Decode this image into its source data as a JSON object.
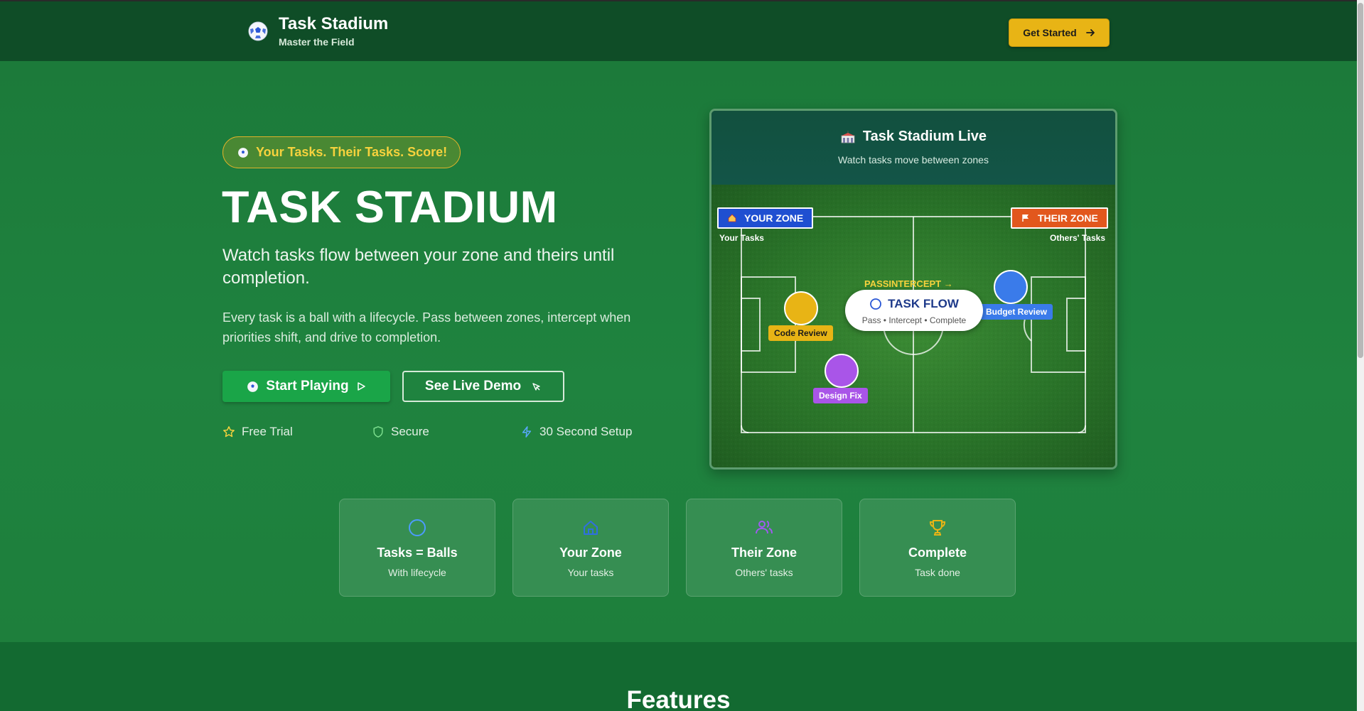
{
  "header": {
    "brand_title": "Task Stadium",
    "brand_subtitle": "Master the Field",
    "cta_label": "Get Started"
  },
  "hero": {
    "pill": "Your Tasks. Their Tasks. Score!",
    "title": "TASK STADIUM",
    "subtitle": "Watch tasks flow between your zone and theirs until completion.",
    "body": "Every task is a ball with a lifecycle. Pass between zones, intercept when priorities shift, and drive to completion.",
    "primary_button": "Start Playing",
    "secondary_button": "See Live Demo",
    "trust": [
      {
        "icon": "star-icon",
        "label": "Free Trial"
      },
      {
        "icon": "shield-icon",
        "label": "Secure"
      },
      {
        "icon": "lightning-icon",
        "label": "30 Second Setup"
      }
    ]
  },
  "demo": {
    "title": "Task Stadium Live",
    "subtitle": "Watch tasks move between zones",
    "your_zone": "YOUR ZONE",
    "your_zone_label": "Your Tasks",
    "their_zone": "THEIR ZONE",
    "their_zone_label": "Others' Tasks",
    "pass_label": "PASSINTERCEPT →",
    "flow_title": "TASK FLOW",
    "flow_sub": "Pass • Intercept • Complete",
    "balls": [
      {
        "label": "Code Review"
      },
      {
        "label": "Design Fix"
      },
      {
        "label": "Budget Review"
      }
    ]
  },
  "features": [
    {
      "icon": "circle-icon",
      "title": "Tasks = Balls",
      "subtitle": "With lifecycle"
    },
    {
      "icon": "home-icon",
      "title": "Your Zone",
      "subtitle": "Your tasks"
    },
    {
      "icon": "users-icon",
      "title": "Their Zone",
      "subtitle": "Others' tasks"
    },
    {
      "icon": "trophy-icon",
      "title": "Complete",
      "subtitle": "Task done"
    }
  ],
  "section": {
    "heading": "Features"
  },
  "colors": {
    "brand_green": "#1d7a3c",
    "header_green": "#0f4d27",
    "accent_gold": "#e8b415",
    "cta_green": "#1aa548",
    "your_zone_blue": "#1f4fd1",
    "their_zone_orange": "#e2571d"
  }
}
